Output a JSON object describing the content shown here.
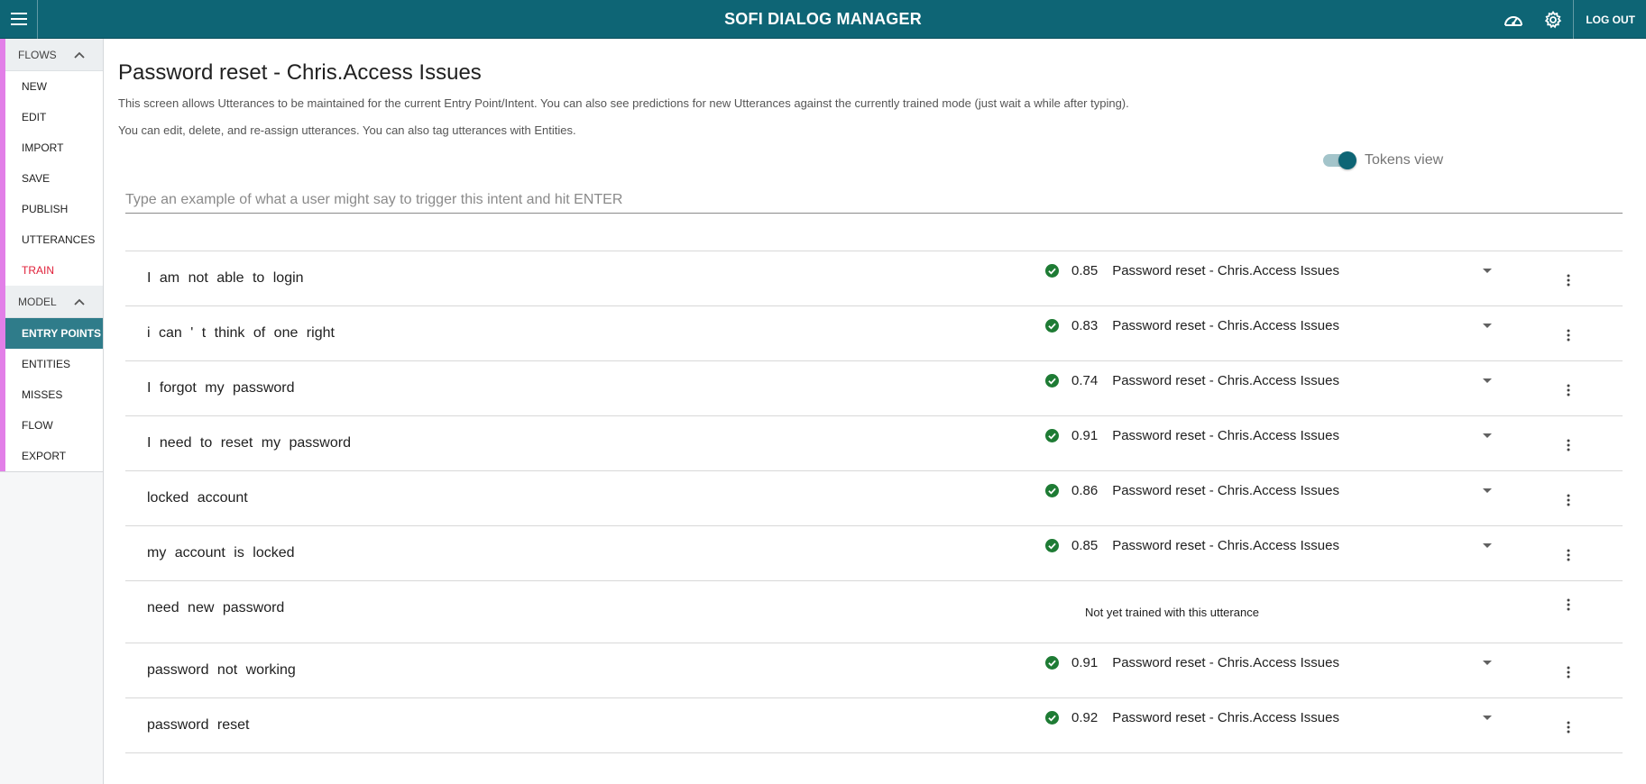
{
  "header": {
    "title": "SOFI DIALOG MANAGER",
    "logout_label": "LOG OUT",
    "icons": [
      "menu-icon",
      "dashboard-icon",
      "gear-icon"
    ],
    "color": "#0e6575"
  },
  "sidebar": {
    "groups": [
      {
        "label": "FLOWS",
        "items": [
          "NEW",
          "EDIT",
          "IMPORT",
          "SAVE",
          "PUBLISH",
          "UTTERANCES",
          "TRAIN"
        ]
      },
      {
        "label": "MODEL",
        "items": [
          "ENTRY POINTS",
          "ENTITIES",
          "MISSES",
          "FLOW",
          "EXPORT"
        ]
      }
    ],
    "active_item": "ENTRY POINTS",
    "highlight_item": "TRAIN",
    "accent_color": "#e27fe8"
  },
  "main": {
    "title": "Password reset - Chris.Access Issues",
    "description_1": "This screen allows Utterances to be maintained for the current Entry Point/Intent. You can also see predictions for new Utterances against the currently trained mode (just wait a while after typing).",
    "description_2": "You can edit, delete, and re-assign utterances. You can also tag utterances with Entities.",
    "toggle_label": "Tokens view",
    "toggle_on": true,
    "input_placeholder": "Type an example of what a user might say to trigger this intent and hit ENTER",
    "input_value": "",
    "utterances": [
      {
        "text": "I am not able to login",
        "score": "0.85",
        "intent": "Password reset - Chris.Access Issues"
      },
      {
        "text": "i can ' t think of one right",
        "score": "0.83",
        "intent": "Password reset - Chris.Access Issues"
      },
      {
        "text": "I forgot my password",
        "score": "0.74",
        "intent": "Password reset - Chris.Access Issues"
      },
      {
        "text": "I need to reset my password",
        "score": "0.91",
        "intent": "Password reset - Chris.Access Issues"
      },
      {
        "text": "locked account",
        "score": "0.86",
        "intent": "Password reset - Chris.Access Issues"
      },
      {
        "text": "my account is locked",
        "score": "0.85",
        "intent": "Password reset - Chris.Access Issues"
      },
      {
        "text": "need new password",
        "status": "Not yet trained with this utterance"
      },
      {
        "text": "password not working",
        "score": "0.91",
        "intent": "Password reset - Chris.Access Issues"
      },
      {
        "text": "password reset",
        "score": "0.92",
        "intent": "Password reset - Chris.Access Issues"
      }
    ],
    "check_color": "#1e7b34"
  }
}
